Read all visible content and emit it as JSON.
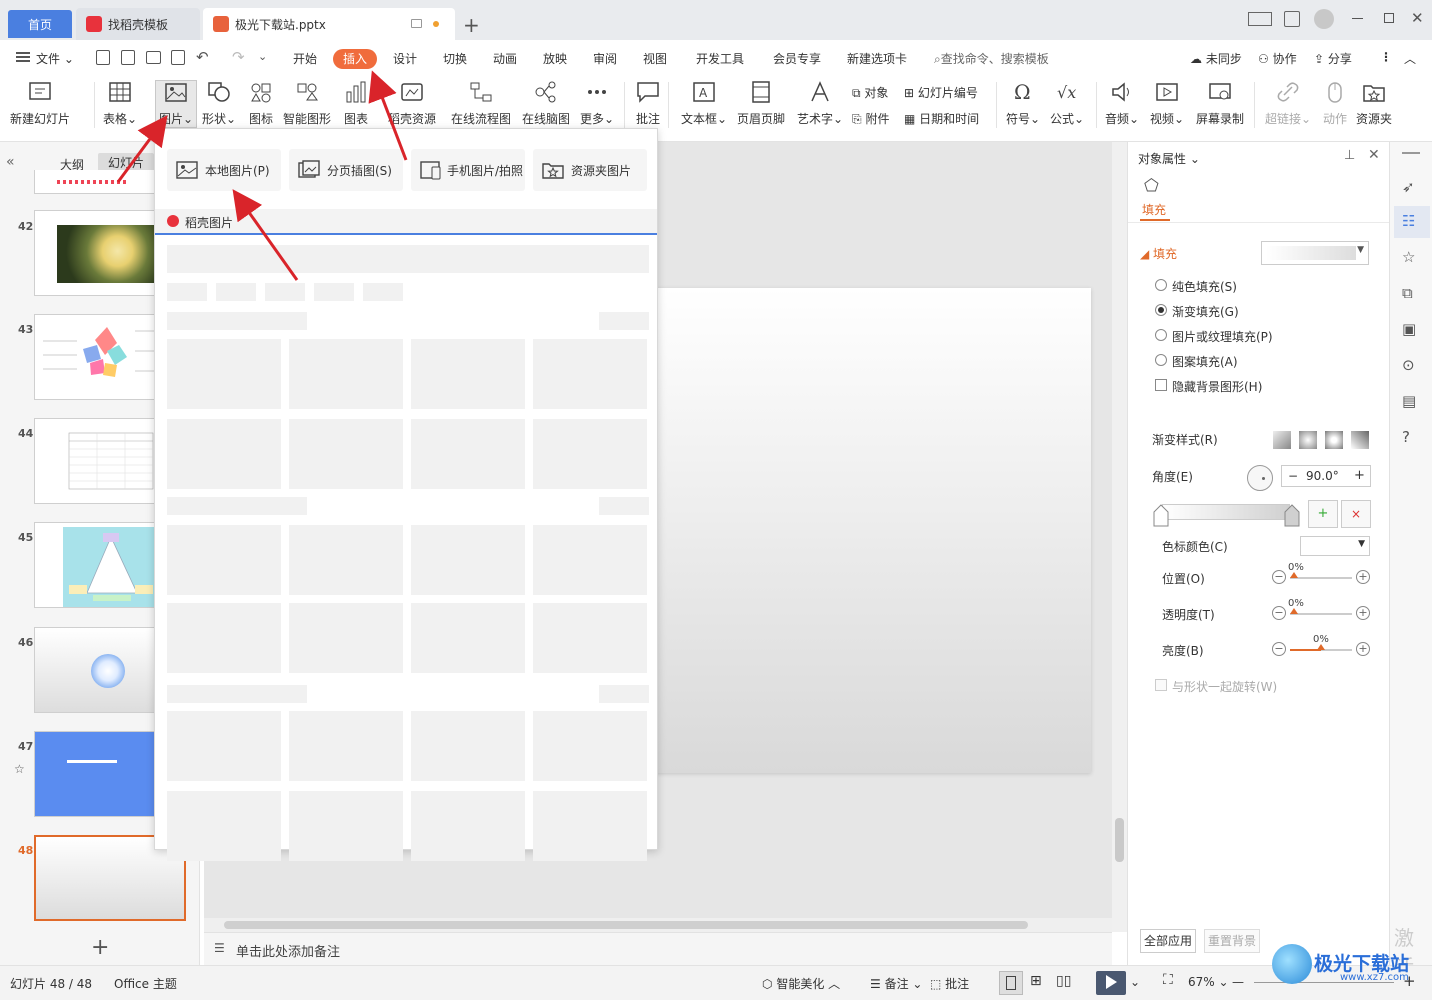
{
  "tabs": {
    "home": "首页",
    "template": "找稻壳模板",
    "document": "极光下载站.pptx"
  },
  "menu": {
    "file": "文件",
    "items": [
      "开始",
      "插入",
      "设计",
      "切换",
      "动画",
      "放映",
      "审阅",
      "视图",
      "开发工具",
      "会员专享",
      "新建选项卡"
    ],
    "active": "插入",
    "search_placeholder": "查找命令、搜索模板",
    "sync": "未同步",
    "collab": "协作",
    "share": "分享"
  },
  "ribbon": {
    "new_slide": "新建幻灯片",
    "table": "表格",
    "picture": "图片",
    "shape": "形状",
    "icon": "图标",
    "smart_graphic": "智能图形",
    "chart": "图表",
    "daoke_resource": "稻壳资源",
    "flowchart": "在线流程图",
    "mindmap": "在线脑图",
    "more": "更多",
    "comment": "批注",
    "textbox": "文本框",
    "header_footer": "页眉页脚",
    "wordart": "艺术字",
    "object": "对象",
    "slide_number": "幻灯片编号",
    "attachment": "附件",
    "datetime": "日期和时间",
    "symbol": "符号",
    "formula": "公式",
    "audio": "音频",
    "video": "视频",
    "screen_record": "屏幕录制",
    "hyperlink": "超链接",
    "action": "动作",
    "resource_folder": "资源夹"
  },
  "left_panel": {
    "tab_outline": "大纲",
    "tab_slides": "幻灯片",
    "slide_numbers": [
      "42",
      "43",
      "44",
      "45",
      "46",
      "47",
      "48"
    ],
    "selected": "48"
  },
  "dropdown": {
    "local_picture": "本地图片(P)",
    "paged_insert": "分页插图(S)",
    "phone_picture": "手机图片/拍照",
    "folder_picture": "资源夹图片",
    "daoke_pictures": "稻壳图片"
  },
  "notes": {
    "placeholder": "单击此处添加备注"
  },
  "right_panel": {
    "title": "对象属性",
    "tab_fill": "填充",
    "section_fill": "填充",
    "options": [
      "纯色填充(S)",
      "渐变填充(G)",
      "图片或纹理填充(P)",
      "图案填充(A)"
    ],
    "selected_option": "渐变填充(G)",
    "hide_bg": "隐藏背景图形(H)",
    "gradient_style": "渐变样式(R)",
    "angle_label": "角度(E)",
    "angle_value": "90.0°",
    "stop_color": "色标颜色(C)",
    "position_label": "位置(O)",
    "position_value": "0%",
    "transparency_label": "透明度(T)",
    "transparency_value": "0%",
    "brightness_label": "亮度(B)",
    "brightness_value": "0%",
    "rotate_with_shape": "与形状一起旋转(W)",
    "apply_all": "全部应用",
    "reset_bg": "重置背景"
  },
  "status": {
    "slide_info": "幻灯片 48 / 48",
    "theme": "Office 主题",
    "beautify": "智能美化",
    "notes": "备注",
    "comments": "批注",
    "zoom": "67%"
  },
  "watermark": {
    "site": "极光下载站",
    "url": "www.xz7.com",
    "activate": "激活"
  },
  "colors": {
    "accent": "#f06c3c",
    "home_tab": "#4a7fe0",
    "arrow": "#d9242a"
  }
}
